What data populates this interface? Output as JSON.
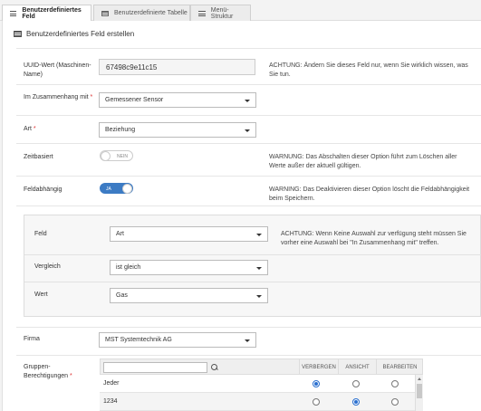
{
  "tabs": [
    {
      "label": "Benutzerdefiniertes Feld",
      "icon": "menu-icon",
      "active": true
    },
    {
      "label": "Benutzerdefinierte Tabelle",
      "icon": "table-icon",
      "active": false
    },
    {
      "label": "Menü-Struktur",
      "icon": "menu-icon",
      "active": false
    }
  ],
  "heading": "Benutzerdefiniertes Feld erstellen",
  "uuid": {
    "label": "UUID-Wert (Maschinen-Name)",
    "value": "67498c9e11c15",
    "note": "ACHTUNG: Ändern Sie dieses Feld nur, wenn Sie wirklich wissen, was Sie tun."
  },
  "context": {
    "label": "Im Zusammenhang mit",
    "required": "*",
    "value": "Gemessener Sensor"
  },
  "type": {
    "label": "Art",
    "required": "*",
    "value": "Beziehung"
  },
  "timebased": {
    "label": "Zeitbasiert",
    "toggle": "NEIN",
    "on": false,
    "note": "WARNUNG: Das Abschalten dieser Option führt zum Löschen aller Werte außer der aktuell gültigen."
  },
  "fielddependent": {
    "label": "Feldabhängig",
    "toggle": "JA",
    "on": true,
    "note": "WARNING: Das Deaktivieren dieser Option löscht die Feldabhängigkeit beim Speichern."
  },
  "dependency": {
    "field": {
      "label": "Feld",
      "value": "Art"
    },
    "field_note": "ACHTUNG: Wenn Keine Auswahl zur verfügung steht müssen Sie vorher eine Auswahl bei \"In Zusammenhang mit\" treffen.",
    "comparison": {
      "label": "Vergleich",
      "value": "ist gleich"
    },
    "value": {
      "label": "Wert",
      "value": "Gas"
    }
  },
  "company": {
    "label": "Firma",
    "value": "MST Systemtechnik AG"
  },
  "permissions": {
    "label": "Gruppen-Berechtigungen",
    "required": "*",
    "search_placeholder": "",
    "columns": [
      "VERBERGEN",
      "ANSICHT",
      "BEARBEITEN"
    ],
    "rows": [
      {
        "name": "Jeder",
        "selected": "VERBERGEN"
      },
      {
        "name": "1234",
        "selected": "ANSICHT"
      }
    ]
  },
  "colors": {
    "accent": "#3c7bc4",
    "radio": "#2a6fcf"
  }
}
